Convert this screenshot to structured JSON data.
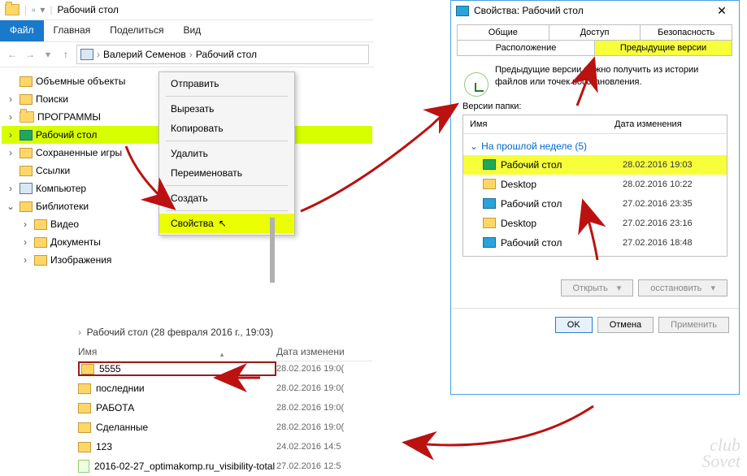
{
  "explorer": {
    "title": "Рабочий стол",
    "ribbon": {
      "file": "Файл",
      "home": "Главная",
      "share": "Поделиться",
      "view": "Вид"
    },
    "breadcrumb": [
      "Валерий Семенов",
      "Рабочий стол"
    ],
    "tree": [
      {
        "exp": "",
        "icon": "cube",
        "label": "Объемные объекты"
      },
      {
        "exp": ">",
        "icon": "search",
        "label": "Поиски"
      },
      {
        "exp": ">",
        "icon": "folder",
        "label": "ПРОГРАММЫ"
      },
      {
        "exp": ">",
        "icon": "desktop",
        "label": "Рабочий стол",
        "hl": true
      },
      {
        "exp": ">",
        "icon": "save",
        "label": "Сохраненные игры"
      },
      {
        "exp": "",
        "icon": "link",
        "label": "Ссылки"
      },
      {
        "exp": ">",
        "icon": "pc",
        "label": "Компьютер"
      },
      {
        "exp": "v",
        "icon": "lib",
        "label": "Библиотеки"
      },
      {
        "exp": ">",
        "icon": "video",
        "label": "Видео",
        "indent": 1
      },
      {
        "exp": ">",
        "icon": "doc",
        "label": "Документы",
        "indent": 1
      },
      {
        "exp": ">",
        "icon": "img",
        "label": "Изображения",
        "indent": 1
      }
    ]
  },
  "context_menu": {
    "items": [
      "Отправить",
      "Вырезать",
      "Копировать",
      "Удалить",
      "Переименовать",
      "Создать",
      "Свойства"
    ],
    "highlighted": "Свойства"
  },
  "properties": {
    "title": "Свойства: Рабочий стол",
    "tabs_row1": [
      "Общие",
      "Доступ",
      "Безопасность"
    ],
    "tabs_row2": [
      "Расположение",
      "Предыдущие версии"
    ],
    "highlighted_tab": "Предыдущие версии",
    "desc": "Предыдущие версии можно получить из истории файлов или точек восстановления.",
    "versions_label": "Версии папки:",
    "columns": {
      "name": "Имя",
      "date": "Дата изменения"
    },
    "group": "На прошлой неделе (5)",
    "rows": [
      {
        "icon": "desktop",
        "name": "Рабочий стол",
        "date": "28.02.2016 19:03",
        "hl": true
      },
      {
        "icon": "folder",
        "name": "Desktop",
        "date": "28.02.2016 10:22"
      },
      {
        "icon": "desktop",
        "name": "Рабочий стол",
        "date": "27.02.2016 23:35"
      },
      {
        "icon": "folder",
        "name": "Desktop",
        "date": "27.02.2016 23:16"
      },
      {
        "icon": "desktop",
        "name": "Рабочий стол",
        "date": "27.02.2016 18:48"
      }
    ],
    "buttons": {
      "open": "Открыть",
      "restore": "осстановить"
    },
    "dlg": {
      "ok": "OK",
      "cancel": "Отмена",
      "apply": "Применить"
    }
  },
  "bottom": {
    "breadcrumb": "Рабочий стол (28 февраля 2016 г., 19:03)",
    "columns": {
      "name": "Имя",
      "date": "Дата изменени"
    },
    "rows": [
      {
        "icon": "folder",
        "name": "5555",
        "date": "28.02.2016 19:0(",
        "boxed": true
      },
      {
        "icon": "folder",
        "name": "последнии",
        "date": "28.02.2016 19:0("
      },
      {
        "icon": "folder",
        "name": "РАБОТА",
        "date": "28.02.2016 19:0("
      },
      {
        "icon": "folder",
        "name": "Сделанные",
        "date": "28.02.2016 19:0("
      },
      {
        "icon": "folder",
        "name": "123",
        "date": "24.02.2016 14:5"
      },
      {
        "icon": "file",
        "name": "2016-02-27_optimakomp.ru_visibility-total",
        "date": "27.02.2016 12:5"
      }
    ]
  },
  "watermark": {
    "l1": "club",
    "l2": "Sovet"
  }
}
